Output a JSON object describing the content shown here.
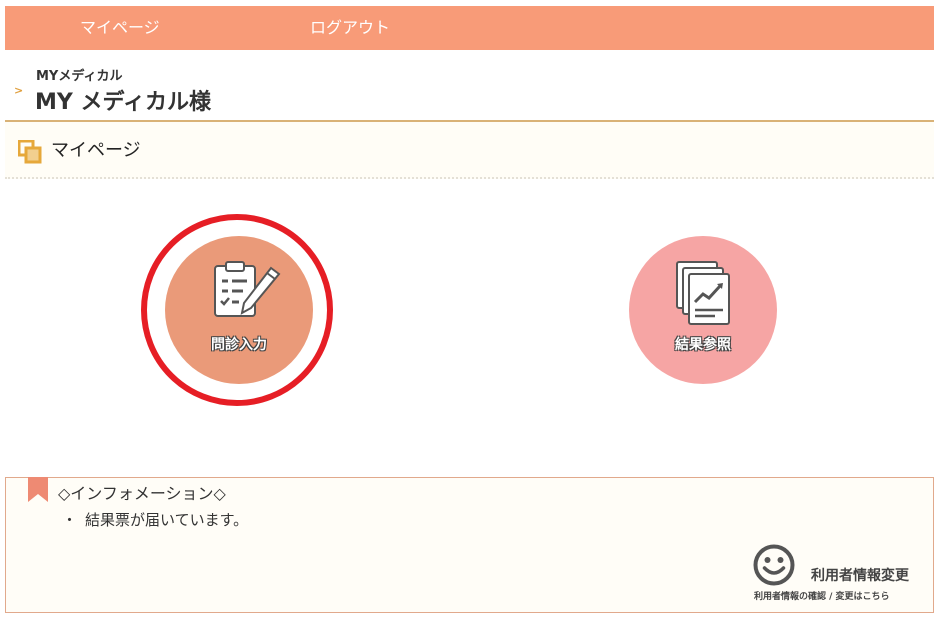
{
  "nav": {
    "mypage": "マイページ",
    "logout": "ログアウト"
  },
  "header": {
    "sub": "MYメディカル",
    "title": "MY メディカル様"
  },
  "section": {
    "title": "マイページ"
  },
  "menu": {
    "monshin_label": "問診入力",
    "kekka_label": "結果参照"
  },
  "info": {
    "title": "◇インフォメーション◇",
    "bullet": "・",
    "items": [
      "結果票が届いています。"
    ]
  },
  "user_change": {
    "title": "利用者情報変更",
    "sub": "利用者情報の確認 / 変更はこちら"
  },
  "colors": {
    "nav_bg": "#f89b78",
    "monshin_btn": "#ea9a79",
    "kekka_btn": "#f6a5a4",
    "highlight_ring": "#e61e25",
    "header_line": "#d9b277",
    "info_border": "#e1a98c"
  },
  "icons": {
    "header_arrow": "chevron-right-icon",
    "section": "overlapping-squares-icon",
    "monshin": "clipboard-pencil-icon",
    "kekka": "documents-chart-icon",
    "info": "bookmark-ribbon-icon",
    "user_change": "smiley-face-icon"
  }
}
